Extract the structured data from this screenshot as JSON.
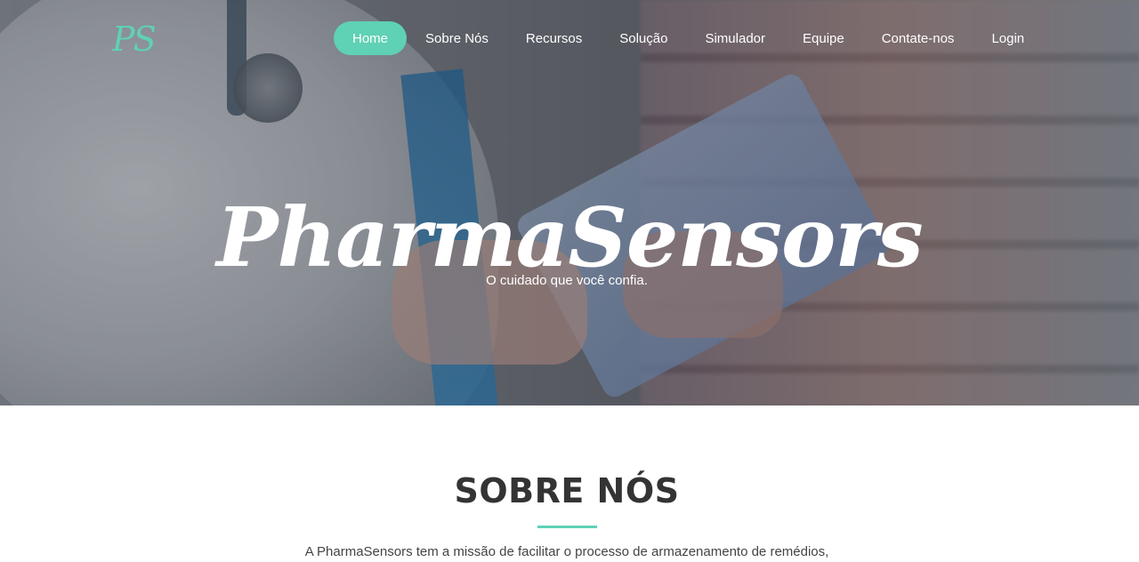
{
  "brand": {
    "logo_text": "PS",
    "accent_color": "#5fd1b4"
  },
  "nav": {
    "items": [
      {
        "label": "Home",
        "active": true
      },
      {
        "label": "Sobre Nós",
        "active": false
      },
      {
        "label": "Recursos",
        "active": false
      },
      {
        "label": "Solução",
        "active": false
      },
      {
        "label": "Simulador",
        "active": false
      },
      {
        "label": "Equipe",
        "active": false
      },
      {
        "label": "Contate-nos",
        "active": false
      },
      {
        "label": "Login",
        "active": false
      }
    ]
  },
  "hero": {
    "title": "PharmaSensors",
    "subtitle": "O cuidado que você confia."
  },
  "about": {
    "title": "SOBRE NÓS",
    "text": "A PharmaSensors tem a missão de facilitar o processo de armazenamento de remédios,"
  }
}
